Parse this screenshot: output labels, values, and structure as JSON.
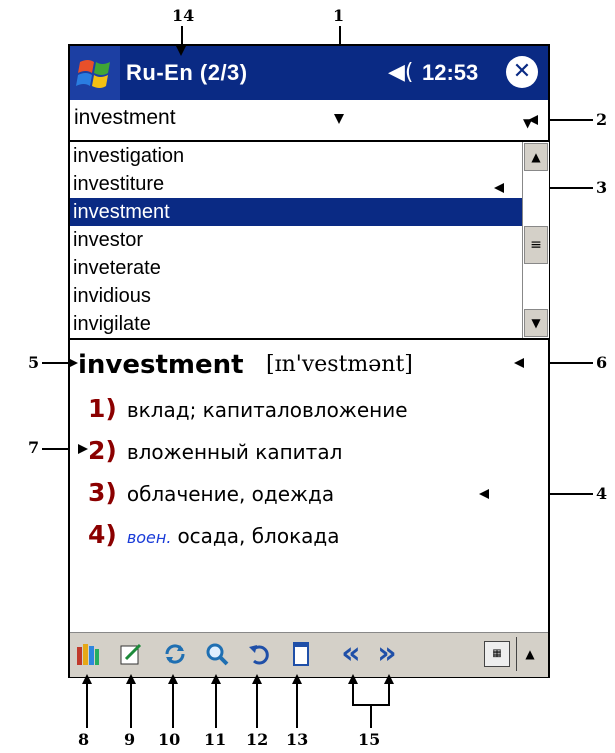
{
  "callouts": [
    "1",
    "2",
    "3",
    "4",
    "5",
    "6",
    "7",
    "8",
    "9",
    "10",
    "11",
    "12",
    "13",
    "14",
    "15"
  ],
  "titlebar": {
    "title": "Ru-En  (2/3)",
    "time": "12:53",
    "speaker_glyph": "◀(",
    "close_glyph": "✕"
  },
  "search": {
    "value": "investment"
  },
  "wordlist": {
    "items": [
      "investigation",
      "investiture",
      "investment",
      "investor",
      "inveterate",
      "invidious",
      "invigilate"
    ],
    "selected": "investment"
  },
  "article": {
    "headword": "investment",
    "transcription": "[ɪn'vestmənt]",
    "senses": [
      {
        "num": "1)",
        "label": "",
        "text": "вклад; капиталовложение"
      },
      {
        "num": "2)",
        "label": "",
        "text": "вложенный капитал"
      },
      {
        "num": "3)",
        "label": "",
        "text": "облачение, одежда"
      },
      {
        "num": "4)",
        "label": "воен.",
        "text": "осада, блокада"
      }
    ]
  },
  "toolbar": {
    "icons": [
      "dictionaries-icon",
      "edit-icon",
      "switch-direction-icon",
      "search-icon",
      "back-icon",
      "card-icon",
      "previous-icon",
      "next-icon"
    ],
    "prev_glyph": "«",
    "next_glyph": "»"
  },
  "colors": {
    "titlebar": "#0a2a84",
    "selection": "#0a2a84",
    "sense_number": "#8b0000",
    "label": "#1a3cd8",
    "toolbar": "#d4d0c8"
  }
}
